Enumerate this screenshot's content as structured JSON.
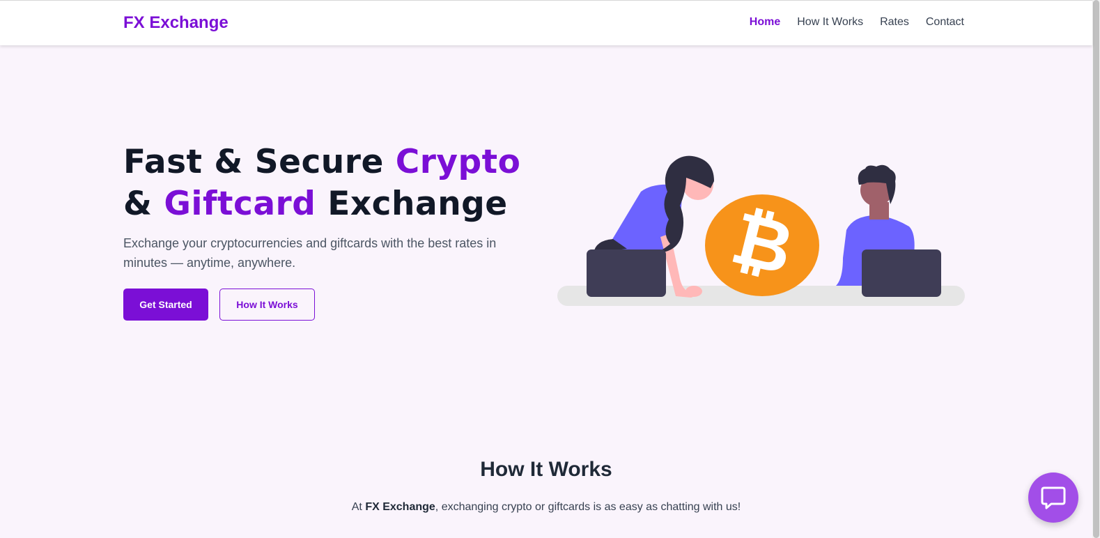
{
  "nav": {
    "brand": "FX Exchange",
    "links": [
      {
        "label": "Home",
        "active": true
      },
      {
        "label": "How It Works",
        "active": false
      },
      {
        "label": "Rates",
        "active": false
      },
      {
        "label": "Contact",
        "active": false
      }
    ]
  },
  "hero": {
    "title_part1": "Fast & Secure ",
    "title_accent1": "Crypto",
    "title_part2": "& ",
    "title_accent2": "Giftcard",
    "title_part3": " Exchange",
    "subtitle": "Exchange your cryptocurrencies and giftcards with the best rates in minutes — anytime, anywhere.",
    "primary_button": "Get Started",
    "secondary_button": "How It Works",
    "illustration_icon": "bitcoin-icon"
  },
  "how_it_works": {
    "title": "How It Works",
    "text_prefix": "At ",
    "text_brand": "FX Exchange",
    "text_suffix": ", exchanging crypto or giftcards is as easy as chatting with us!"
  },
  "chat_widget": {
    "icon": "chat-bubble-icon"
  },
  "colors": {
    "accent": "#7b0fd6",
    "background": "#faf4fc",
    "chat_button": "#a24ee8",
    "bitcoin": "#f7931a",
    "figure_shirt": "#6c63ff",
    "laptop": "#3f3d56"
  }
}
